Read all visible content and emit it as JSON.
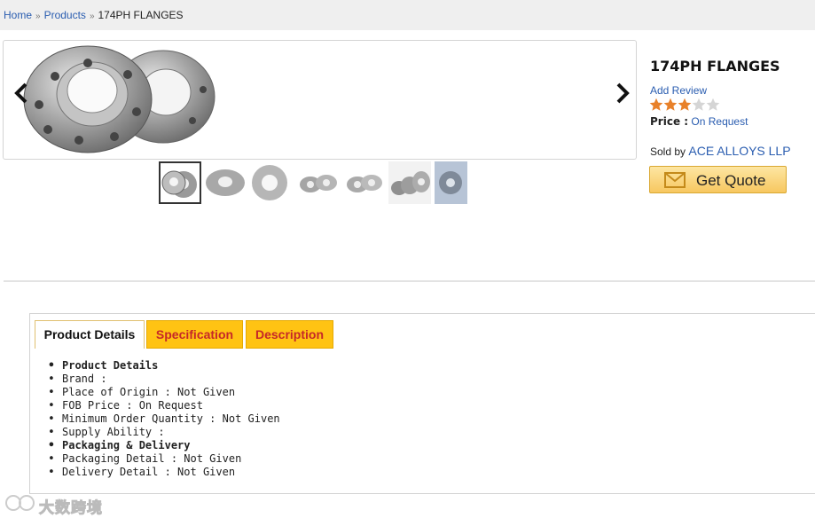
{
  "breadcrumb": {
    "items": [
      "Home",
      "Products"
    ],
    "separator": "»",
    "current": "174PH FLANGES"
  },
  "gallery": {
    "prev_icon": "chevron-left-icon",
    "next_icon": "chevron-right-icon",
    "image_label": "flange-image",
    "thumbnail_count": 7,
    "active_thumbnail": 1
  },
  "product": {
    "title": "174PH FLANGES",
    "add_review": "Add Review",
    "rating": 3,
    "rating_max": 5,
    "price_label": "Price :",
    "price_value": "On Request",
    "sold_by_label": "Sold by",
    "seller": "ACE ALLOYS LLP",
    "quote_button": "Get Quote",
    "quote_icon": "envelope-icon"
  },
  "tabs": [
    {
      "label": "Product Details",
      "active": true
    },
    {
      "label": "Specification",
      "active": false
    },
    {
      "label": "Description",
      "active": false
    }
  ],
  "details": [
    {
      "text": "Product Details",
      "heading": true
    },
    {
      "text": "Brand :",
      "heading": false
    },
    {
      "text": "Place of Origin : Not Given",
      "heading": false
    },
    {
      "text": "FOB Price : On Request",
      "heading": false
    },
    {
      "text": "Minimum Order Quantity : Not Given",
      "heading": false
    },
    {
      "text": "Supply Ability :",
      "heading": false
    },
    {
      "text": "Packaging & Delivery",
      "heading": true
    },
    {
      "text": "Packaging Detail : Not Given",
      "heading": false
    },
    {
      "text": "Delivery Detail : Not Given",
      "heading": false
    }
  ],
  "watermark": {
    "text": "大数跨境"
  },
  "colors": {
    "link": "#2a5db0",
    "tab_bg": "#ffc313",
    "tab_text": "#c62828",
    "star_on": "#e8812a",
    "star_off": "#d5d5d5"
  }
}
